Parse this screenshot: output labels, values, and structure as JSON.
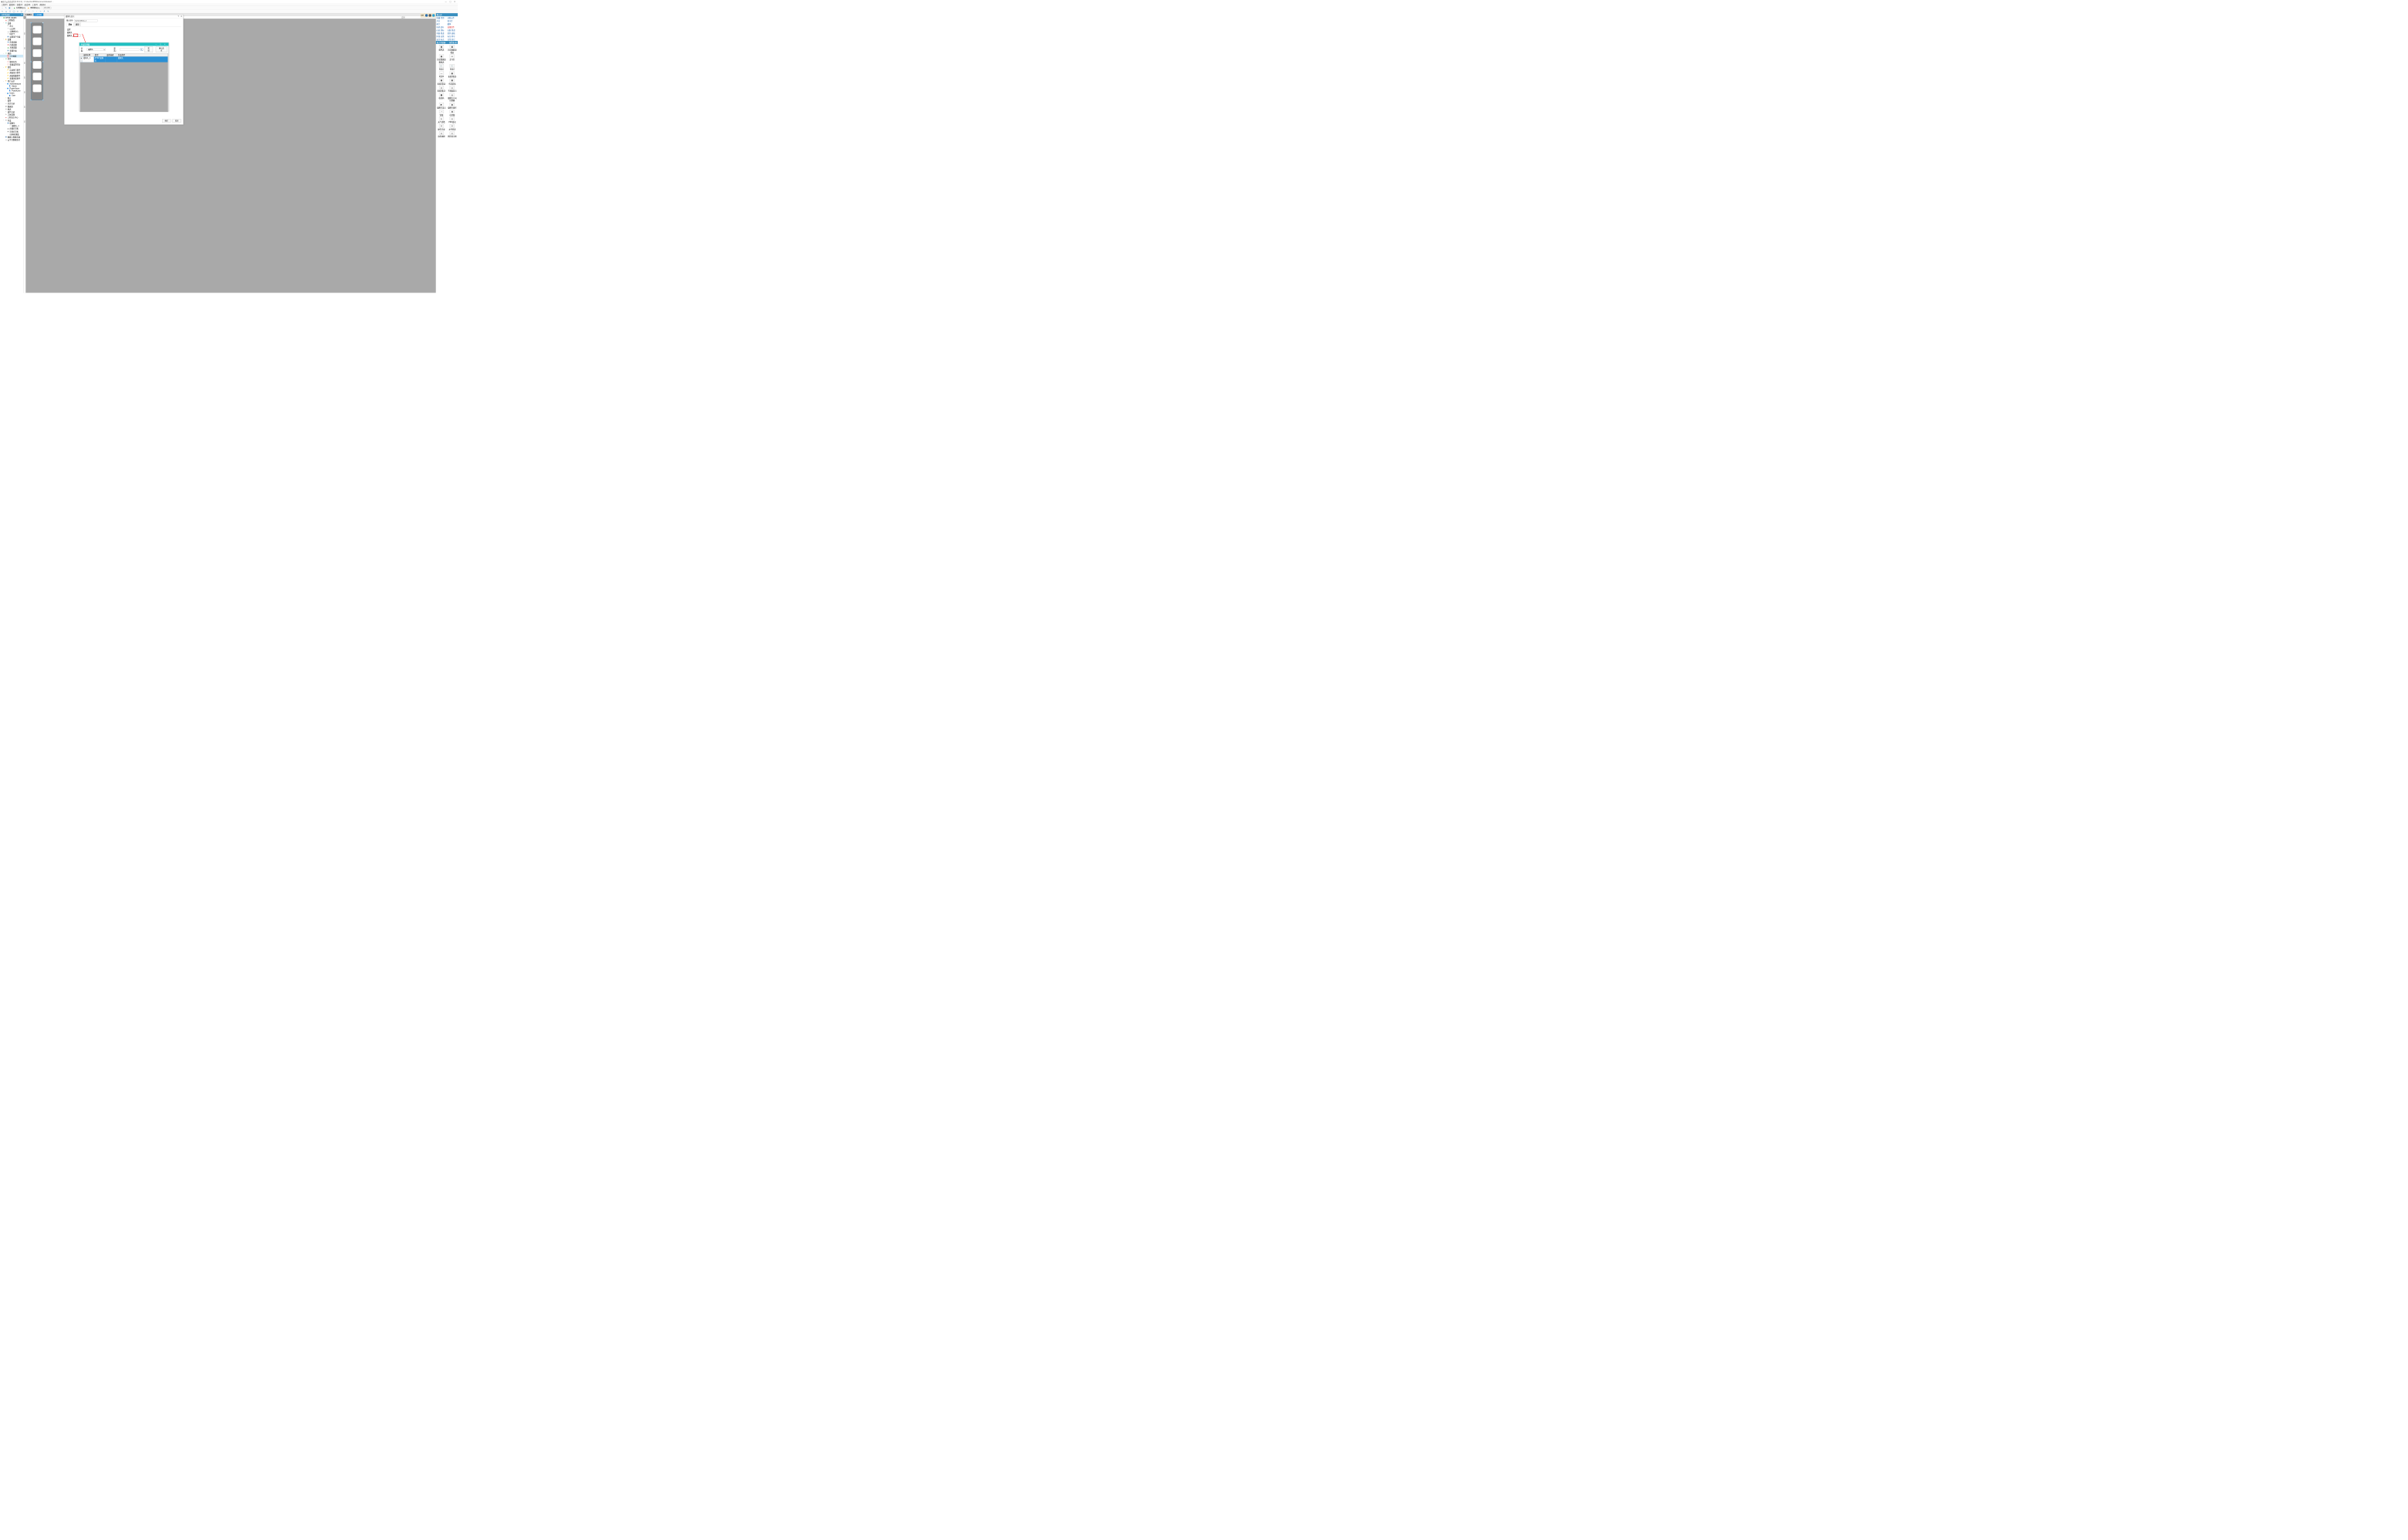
{
  "window": {
    "title": "海为云组态软件[3.36.0.4] - C:\\Users\\12658\\Documents\\Haiwell ...",
    "min": "—",
    "max": "▢",
    "close": "✕"
  },
  "menu": [
    "工程(P)",
    "编辑(E)",
    "查看(V)",
    "调试(D)",
    "工具(T)",
    "帮助(H)"
  ],
  "toolbar": {
    "online": "在线模拟(F5)",
    "offline": "离线模拟(F6)",
    "ip": "192.168.1"
  },
  "left_panel": {
    "title": "工程浏览器",
    "close": "✕"
  },
  "tree": [
    {
      "d": 0,
      "tw": "−",
      "ic": "▣",
      "cls": "ico-green",
      "t": "RTSP_DEMO"
    },
    {
      "d": 1,
      "tw": "",
      "ic": "▤",
      "cls": "ico-red",
      "t": "工程属性"
    },
    {
      "d": 1,
      "tw": "−",
      "ic": "⚙",
      "cls": "ico-cyan",
      "t": "设备"
    },
    {
      "d": 2,
      "tw": "",
      "ic": "Ψ",
      "cls": "ico-gray",
      "t": "串口"
    },
    {
      "d": 2,
      "tw": "",
      "ic": "≋",
      "cls": "ico-gray",
      "t": "以太网"
    },
    {
      "d": 2,
      "tw": "",
      "ic": "☁",
      "cls": "ico-gray",
      "t": "云数据中心"
    },
    {
      "d": 2,
      "tw": "",
      "ic": "✎",
      "cls": "ico-gray",
      "t": "MQTT"
    },
    {
      "d": 2,
      "tw": "",
      "ic": "▦",
      "cls": "ico-blue",
      "t": "设备用户分类"
    },
    {
      "d": 1,
      "tw": "−",
      "ic": "◆",
      "cls": "ico-orange",
      "t": "变量"
    },
    {
      "d": 2,
      "tw": "",
      "ic": "◆",
      "cls": "ico-blue",
      "t": "外部变量"
    },
    {
      "d": 2,
      "tw": "",
      "ic": "◆",
      "cls": "ico-red",
      "t": "内部变量"
    },
    {
      "d": 2,
      "tw": "",
      "ic": "◆",
      "cls": "ico-green",
      "t": "系统变量"
    },
    {
      "d": 2,
      "tw": "",
      "ic": "▦",
      "cls": "ico-blue",
      "t": "变量分类"
    },
    {
      "d": 1,
      "tw": "−",
      "ic": "▭",
      "cls": "ico-green",
      "t": "画面"
    },
    {
      "d": 2,
      "tw": "",
      "ic": "1",
      "cls": "red-box",
      "t": "1:主画面",
      "sel": true
    },
    {
      "d": 1,
      "tw": "−",
      "ic": "☑",
      "cls": "ico-green",
      "t": "任务"
    },
    {
      "d": 2,
      "tw": "",
      "ic": "◯",
      "cls": "ico-red",
      "t": "脚本任务"
    },
    {
      "d": 2,
      "tw": "",
      "ic": "◯",
      "cls": "ico-red",
      "t": "变量设置任务"
    },
    {
      "d": 1,
      "tw": "−",
      "ic": "⚡",
      "cls": "ico-yel",
      "t": "事件"
    },
    {
      "d": 2,
      "tw": "",
      "ic": "⚡",
      "cls": "ico-yel",
      "t": "启动执行事件"
    },
    {
      "d": 2,
      "tw": "",
      "ic": "⚡",
      "cls": "ico-yel",
      "t": "画面显示事件"
    },
    {
      "d": 2,
      "tw": "",
      "ic": "⚡",
      "cls": "ico-yel",
      "t": "画面隐藏事件"
    },
    {
      "d": 2,
      "tw": "",
      "ic": "⚡",
      "cls": "ico-yel",
      "t": "变量改变事件"
    },
    {
      "d": 1,
      "tw": "−",
      "ic": "♣",
      "cls": "ico-orange",
      "t": "用户安全"
    },
    {
      "d": 2,
      "tw": "−",
      "ic": "👥",
      "cls": "ico-orange",
      "t": "Administrators"
    },
    {
      "d": 3,
      "tw": "",
      "ic": "👤",
      "cls": "ico-blue",
      "t": "Admin"
    },
    {
      "d": 2,
      "tw": "−",
      "ic": "👥",
      "cls": "ico-orange",
      "t": "PowerUsers"
    },
    {
      "d": 3,
      "tw": "",
      "ic": "👤",
      "cls": "ico-blue",
      "t": "PowerUser"
    },
    {
      "d": 2,
      "tw": "−",
      "ic": "👥",
      "cls": "ico-orange",
      "t": "Users"
    },
    {
      "d": 3,
      "tw": "",
      "ic": "👤",
      "cls": "ico-blue",
      "t": "User"
    },
    {
      "d": 1,
      "tw": "",
      "ic": "≡",
      "cls": "ico-yel",
      "t": "配方"
    },
    {
      "d": 1,
      "tw": "",
      "ic": "!",
      "cls": "ico-red",
      "t": "报警"
    },
    {
      "d": 1,
      "tw": "",
      "ic": "⟲",
      "cls": "ico-gray",
      "t": "历史记录"
    },
    {
      "d": 1,
      "tw": "",
      "ic": "▦",
      "cls": "ico-gray",
      "t": "数据组"
    },
    {
      "d": 1,
      "tw": "",
      "ic": "▤",
      "cls": "ico-gray",
      "t": "报表"
    },
    {
      "d": 1,
      "tw": "",
      "ic": "✎",
      "cls": "ico-gray",
      "t": "操作记录"
    },
    {
      "d": 1,
      "tw": "",
      "ic": "A",
      "cls": "ico-gray",
      "t": "字体管理"
    },
    {
      "d": 1,
      "tw": "",
      "ic": "■",
      "cls": "ico-red",
      "t": "工程语言中心"
    },
    {
      "d": 1,
      "tw": "−",
      "ic": "✖",
      "cls": "ico-gray",
      "t": "外设"
    },
    {
      "d": 2,
      "tw": "−",
      "ic": "▣",
      "cls": "ico-blue",
      "t": "摄像头"
    },
    {
      "d": 3,
      "tw": "",
      "ic": "●",
      "cls": "ico-gray",
      "t": "摄像头_1"
    },
    {
      "d": 2,
      "tw": "",
      "ic": "▣",
      "cls": "ico-gray",
      "t": "炜煌打印机"
    },
    {
      "d": 2,
      "tw": "",
      "ic": "▣",
      "cls": "ico-gray",
      "t": "讯普打印机"
    },
    {
      "d": 2,
      "tw": "",
      "ic": "⌕",
      "cls": "ico-gray",
      "t": "扫码枪/键盘"
    },
    {
      "d": 1,
      "tw": "",
      "ic": "▦",
      "cls": "ico-blue",
      "t": "数据上报服务器"
    },
    {
      "d": 1,
      "tw": "",
      "ic": "☁",
      "cls": "ico-gray",
      "t": "云平台数据监控"
    }
  ],
  "center_tabs": {
    "a": "工程概览",
    "b": "1:主画面"
  },
  "ruler_h": [
    "0",
    "100",
    "200",
    "1200"
  ],
  "ruler_v": [
    "0",
    "100",
    "200",
    "300",
    "400",
    "500",
    "600",
    "700"
  ],
  "m1": {
    "title": "摄像头显示",
    "help": "?",
    "close": "✕",
    "name_label": "图元名称",
    "name_value": "CameraShow_1",
    "tabs": {
      "basic": "基本",
      "general": "通用"
    },
    "sec1": "设置",
    "sec2": "摄像头",
    "camera": "摄像头_1",
    "browse": "· · ·",
    "ok": "确定",
    "cancel": "取消"
  },
  "m2": {
    "title": "外设管理器",
    "min": "—",
    "max": "▢",
    "close": "✕",
    "class_label": "分类：",
    "class_value": "摄像头",
    "filter_label": "筛选：",
    "search": "🔍",
    "add": "新增",
    "confirm": "确认选择",
    "hdr": {
      "name": "设备名称",
      "type": "类型",
      "desc": "设备描述",
      "cat": "外设类型"
    },
    "row": {
      "mark": "▸",
      "name": "摄像头_1",
      "type": "RTSP 摄像头",
      "desc": "",
      "cat": "摄像头"
    }
  },
  "right": {
    "strip_ext": "EXT",
    "title_a": "配方浏览器",
    "title_b": "报警表·新",
    "lib_title": "图元库",
    "tabs": [
      "收藏·常用",
      "功能元件",
      "开关",
      "指示灯",
      "阀门",
      "罐体",
      "电机·扇叶",
      "高级控件",
      "仪表·游标",
      "无痕·管道",
      "有痕·管道",
      "形状·面板",
      "环境·自然",
      "标记·符号",
      "安全·标志",
      "日常·其它"
    ],
    "tab_red_idx": 7,
    "items": [
      {
        "i": "▦",
        "t": "报警表"
      },
      {
        "i": "▦",
        "t": "历史数据查看表"
      },
      {
        "i": "▦",
        "t": "历史数据查看报表"
      },
      {
        "i": "▭",
        "t": "走马灯"
      },
      {
        "i": "🕐",
        "t": "时钟1"
      },
      {
        "i": "🕐",
        "t": "时钟2"
      },
      {
        "i": "—",
        "t": "时钟3"
      },
      {
        "i": "▦",
        "t": "表格(预览)"
      },
      {
        "i": "▦",
        "t": "表格(简易)"
      },
      {
        "i": "▦",
        "t": "布局表格"
      },
      {
        "i": "▭",
        "t": "表格(集合)"
      },
      {
        "i": "▭",
        "t": "子画面显示"
      },
      {
        "i": "▩",
        "t": "收款码"
      },
      {
        "i": "◎",
        "t": "摄像头方向控制器"
      },
      {
        "i": "▶",
        "t": "摄像头显示"
      },
      {
        "i": "◉",
        "t": "摄像头操作"
      },
      {
        "i": "◔",
        "t": "饼图"
      },
      {
        "i": "▮",
        "t": "柱状图"
      },
      {
        "i": "☀",
        "t": "天气查看"
      },
      {
        "i": "▭",
        "t": "PDF阅读"
      },
      {
        "i": "▭",
        "t": "操作记录"
      },
      {
        "i": "▭",
        "t": "文件列表"
      },
      {
        "i": "▭",
        "t": "动态画线"
      },
      {
        "i": "▭",
        "t": "网页显示框"
      }
    ]
  }
}
